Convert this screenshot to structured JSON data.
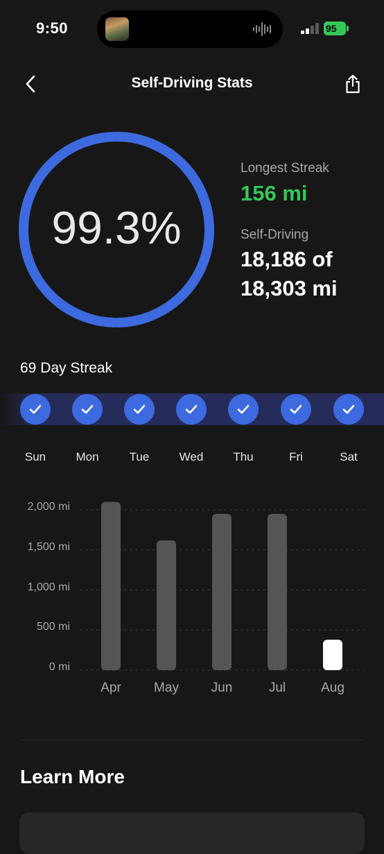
{
  "status_bar": {
    "time": "9:50",
    "battery": "95"
  },
  "header": {
    "title": "Self-Driving Stats"
  },
  "summary": {
    "percent_text": "99.3%",
    "percent_value": 0.993,
    "longest_streak_label": "Longest Streak",
    "longest_streak_value": "156 mi",
    "self_driving_label": "Self-Driving",
    "self_driving_line1": "18,186 of",
    "self_driving_line2": "18,303 mi"
  },
  "streak": {
    "title": "69 Day Streak",
    "days": [
      "Sun",
      "Mon",
      "Tue",
      "Wed",
      "Thu",
      "Fri",
      "Sat"
    ],
    "completed": [
      true,
      true,
      true,
      true,
      true,
      true,
      true
    ]
  },
  "chart_data": {
    "type": "bar",
    "categories": [
      "Apr",
      "May",
      "Jun",
      "Jul",
      "Aug"
    ],
    "values": [
      2100,
      1620,
      1950,
      1950,
      380
    ],
    "highlighted": "Aug",
    "yticks": [
      "2,000 mi",
      "1,500 mi",
      "1,000 mi",
      "500 mi",
      "0 mi"
    ],
    "ylim": [
      0,
      2000
    ],
    "grid": true
  },
  "learn_more": {
    "title": "Learn More"
  },
  "colors": {
    "accent": "#3e6ae0",
    "ring": "#3e6ae0",
    "green": "#34c759",
    "bar": "#555555",
    "bar_active": "#ffffff"
  }
}
